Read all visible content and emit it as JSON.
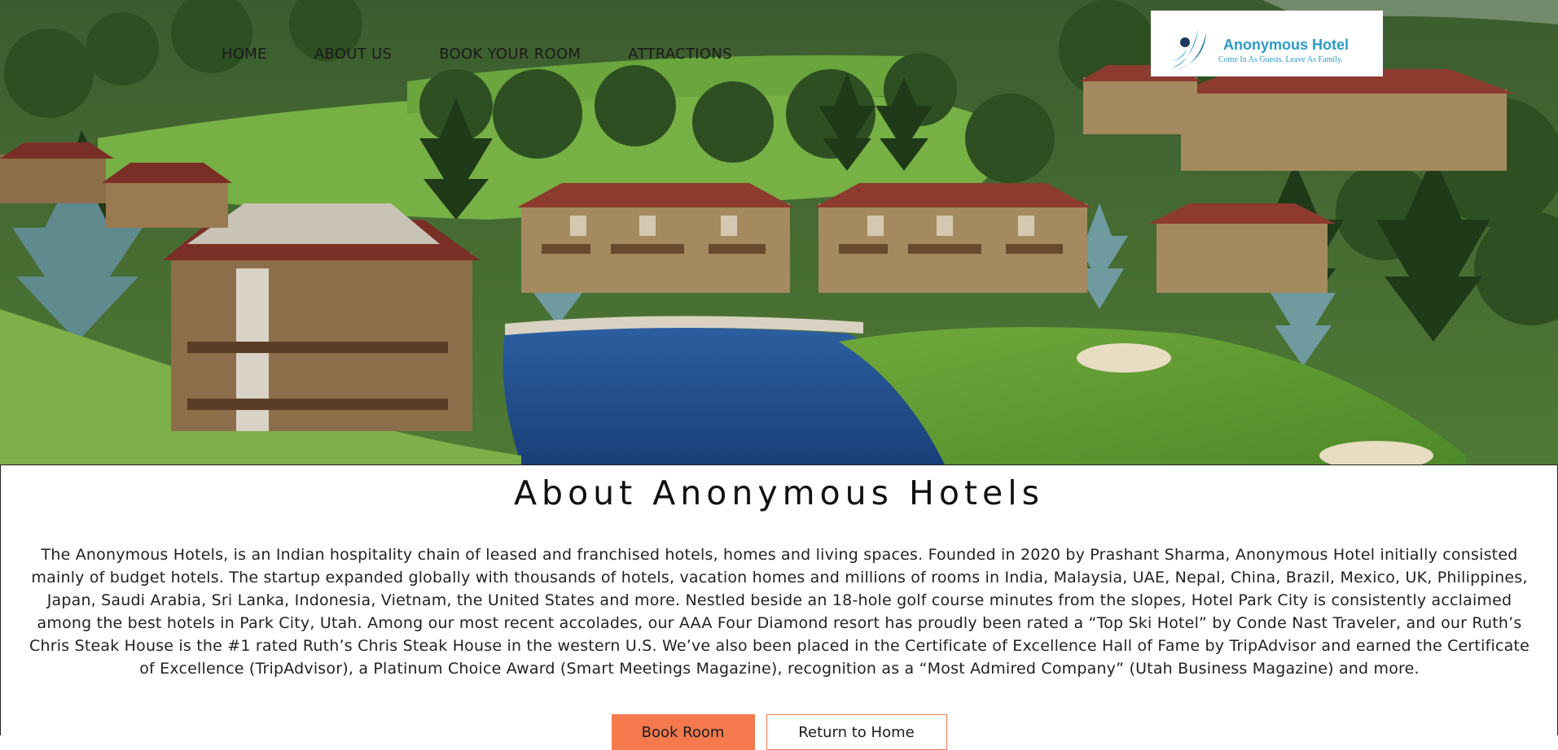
{
  "nav": {
    "items": [
      {
        "label": "HOME"
      },
      {
        "label": "ABOUT US"
      },
      {
        "label": "BOOK YOUR ROOM"
      },
      {
        "label": "ATTRACTIONS"
      }
    ]
  },
  "logo": {
    "title": "Anonymous Hotel",
    "tagline": "Come In As Guests. Leave As Family.",
    "icon": "swoosh-logo-icon",
    "color": "#2a9bc9"
  },
  "hero": {
    "image": "aerial-resort-golf-course-pond"
  },
  "about": {
    "heading": "About Anonymous Hotels",
    "body": "The Anonymous Hotels, is an Indian hospitality chain of leased and franchised hotels, homes and living spaces. Founded in 2020 by Prashant Sharma, Anonymous Hotel initially consisted mainly of budget hotels. The startup expanded globally with thousands of hotels, vacation homes and millions of rooms in India, Malaysia, UAE, Nepal, China, Brazil, Mexico, UK, Philippines, Japan, Saudi Arabia, Sri Lanka, Indonesia, Vietnam, the United States and more. Nestled beside an 18-hole golf course minutes from the slopes, Hotel Park City is consistently acclaimed among the best hotels in Park City, Utah. Among our most recent accolades, our AAA Four Diamond resort has proudly been rated a “Top Ski Hotel” by Conde Nast Traveler, and our Ruth’s Chris Steak House is the #1 rated Ruth’s Chris Steak House in the western U.S. We’ve also been placed in the Certificate of Excellence Hall of Fame by TripAdvisor and earned the Certificate of Excellence (TripAdvisor), a Platinum Choice Award (Smart Meetings Magazine), recognition as a “Most Admired Company” (Utah Business Magazine) and more."
  },
  "buttons": {
    "book_label": "Book Room",
    "home_label": "Return to Home",
    "accent": "#f47a4e"
  }
}
